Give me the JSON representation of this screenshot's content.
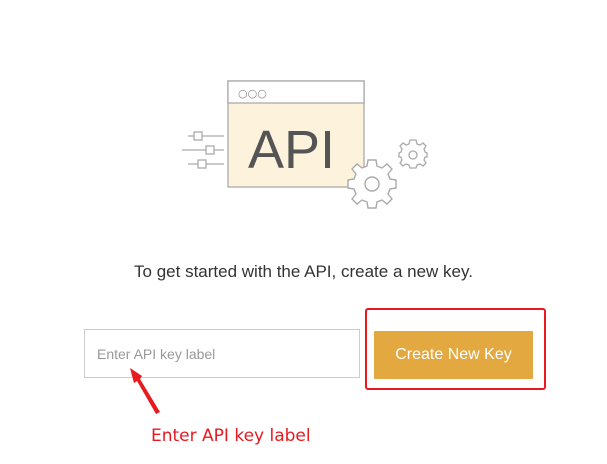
{
  "illustration": {
    "window_dots": "○○○",
    "api_text": "API",
    "icon": "api-window-gears-icon"
  },
  "intro": {
    "text": "To get started with the API, create a new key."
  },
  "form": {
    "key_input_value": "",
    "key_input_placeholder": "Enter API key label",
    "create_button_label": "Create New Key"
  },
  "annotation": {
    "label": "Enter API key label",
    "color": "#e8191f"
  },
  "colors": {
    "accent": "#e3a83f",
    "illustration_fill": "#fdf3dd",
    "illustration_stroke": "#aaaaaa",
    "highlight": "#e8191f"
  }
}
